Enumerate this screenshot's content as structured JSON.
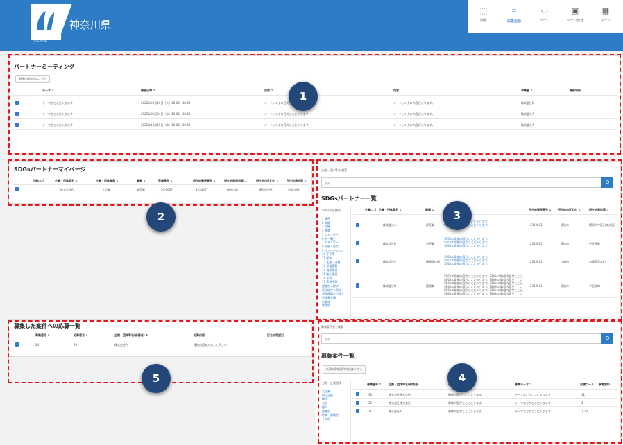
{
  "header": {
    "site_name": "神奈川県",
    "sub_logo_text": "かながわ県"
  },
  "nav": [
    {
      "label": "閲覧",
      "icon": "view-icon"
    },
    {
      "label": "編集画面",
      "icon": "edit-icon"
    },
    {
      "label": "ページ",
      "icon": "page-icon"
    },
    {
      "label": "ページ管理",
      "icon": "page-manage-icon"
    },
    {
      "label": "ホーム",
      "icon": "home-icon"
    }
  ],
  "meeting": {
    "title": "パートナーミーティング",
    "button": "新規作成申込はこちら",
    "columns": [
      "テーマ ↕",
      "開催日時 ↕",
      "目的 ↕",
      "内容",
      "事業者 ↕",
      "開催場所"
    ],
    "rows": [
      [
        "テーマ名ここに入ります",
        "2022年09月10日（火）16:00〜18:00",
        "ミーティングの目的ここに入ります",
        "ミーティングの内容が入ります。",
        "株式会社B",
        ""
      ],
      [
        "テーマ名ここに入ります",
        "2022年09月04日（水）16:00〜18:00",
        "ミーティングの目的ここに入ります",
        "ミーティングの内容が入ります。",
        "株式会社A",
        ""
      ],
      [
        "テーマ名ここに入ります",
        "2022年10月15日（木）16:00〜18:00",
        "ミーティングの目的ここに入ります",
        "ミーティングの内容が入ります。",
        "株式会社A",
        ""
      ]
    ]
  },
  "mypage": {
    "title": "SDGsパートナーマイページ",
    "columns": [
      "企業ロゴ",
      "企業・団体等名 ↕",
      "企業・団体種類 ↕",
      "業種 ↕",
      "登録番号 ↕",
      "所在地郵便番号 ↕",
      "所在地都道府県 ↕",
      "所在地市区町村 ↕",
      "所在地番地等 ↕"
    ],
    "row": [
      "",
      "株式会社A",
      "大企業",
      "卸売業",
      "20-0007",
      "1234567",
      "神奈川県",
      "横浜市中区",
      "日本大通1"
    ]
  },
  "partners": {
    "title": "SDGsパートナー一覧",
    "filter_label": "企業・団体等名 検索",
    "search_placeholder": "検索",
    "search_button": "Q",
    "sidebar_title": "SDGsの目標別",
    "sidebar_items": [
      "1 貧困",
      "2 飢餓",
      "3 保健",
      "4 教育",
      "5 ジェンダー",
      "6 水・衛生",
      "7 エネルギー",
      "8 成長・雇用",
      "9 イノベーション",
      "10 不平等",
      "11 都市",
      "12 生産・消費",
      "13 気候変動",
      "14 海洋資源",
      "15 陸上資源",
      "16 平和",
      "17 実施手段",
      "業種から探す",
      "所在地から探す",
      "団体種類から探す",
      "登録番号順",
      "新着順",
      "地域別"
    ],
    "columns": [
      "企業ロゴ",
      "企業・団体等名 ↕",
      "業種 ↕",
      "取組内容",
      "所在地郵便番号 ↕",
      "所在地市区町村 ↕",
      "所在地番地等 ↕"
    ],
    "rows": [
      {
        "name": "株式会社A",
        "industry": "卸売業",
        "desc": [
          "SDGsの取組内容がここに入ります。",
          "SDGsの取組内容がここに入ります。"
        ],
        "zip": "2310021",
        "city": "横浜市",
        "addr": "横浜市中区日本大通1"
      },
      {
        "name": "株式会社B",
        "industry": "小売業",
        "desc": [
          "SDGsの取組内容がここに入ります。",
          "SDGsの取組内容がここに入ります。",
          "SDGsの取組内容がここに入ります。"
        ],
        "zip": "2310021",
        "city": "横浜市",
        "addr": "中区元町"
      },
      {
        "name": "株式会社C",
        "industry": "情報通信業",
        "desc": [
          "SDGsの取組内容がここに入ります。",
          "SDGsの取組内容がここに入ります。",
          "SDGsの取組内容がここに入ります。"
        ],
        "zip": "2310021",
        "city": "川崎市",
        "addr": "川崎区宮本町"
      },
      {
        "name": "株式会社D",
        "industry": "建設業",
        "desc": [
          "SDGsの取組内容がここに入ります。SDGsの取組内容がここに入ります。",
          "SDGsの取組内容がここに入ります。SDGsの取組内容がここに入ります。",
          "SDGsの取組内容がここに入ります。SDGsの取組内容がここに入ります。",
          "SDGsの取組内容がここに入ります。SDGsの取組内容がここに入ります。",
          "SDGsの取組内容がここに入ります。SDGsの取組内容がここに入ります。",
          "SDGsの取組内容がここに入ります。SDGsの取組内容がここに入ります。"
        ],
        "zip": "2310021",
        "city": "横浜市",
        "addr": "中区本町"
      }
    ]
  },
  "recruit": {
    "title": "募集案件一覧",
    "filter_label": "募集案件名で検索",
    "search_placeholder": "検索",
    "search_button": "Q",
    "button": "新規の募集案件作成はこちら",
    "sidebar_title": "分野・企業規模",
    "sidebar_items": [
      "大企業",
      "中小企業",
      "NPO",
      "大学",
      "個人",
      "業種別",
      "地域・県域別",
      "その他"
    ],
    "columns": [
      "募集番号 ↕",
      "企業・団体等名(募集者)",
      "募集内容",
      "募集テーマ ↕",
      "目標ゴール",
      "参考資料"
    ],
    "rows": [
      [
        "33",
        "株式会社株式会社",
        "募集内容がここに入ります。",
        "テーマなどがここに入ります",
        "11",
        ""
      ],
      [
        "32",
        "株式会社株式会社",
        "募集内容がここに入ります。",
        "テーマなどがここに入ります",
        "4",
        ""
      ],
      [
        "31",
        "株式会社A",
        "募集内容がここに入ります。",
        "テーマなどがここに入ります",
        "7,13",
        ""
      ]
    ]
  },
  "applications": {
    "title": "募集した案件への応募一覧",
    "columns": [
      "募集番号 ↕",
      "応募番号 ↕",
      "企業・団体等名(応募者) ↕",
      "応募内容",
      "打合せ希望日"
    ],
    "row": [
      "24",
      "20",
      "株式会社A",
      "連携内容を入力して下さい",
      ""
    ]
  },
  "annotations": [
    "1",
    "2",
    "3",
    "4",
    "5"
  ]
}
